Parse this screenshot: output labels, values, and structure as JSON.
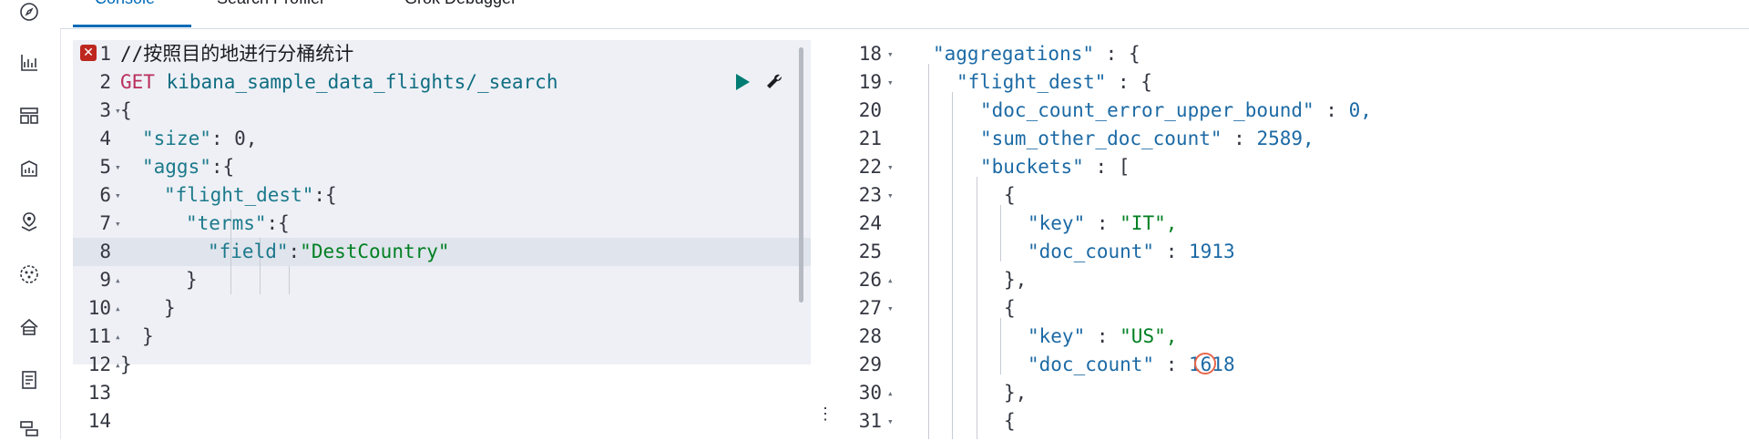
{
  "tabs": [
    {
      "label": "Console"
    },
    {
      "label": "Search Profiler"
    },
    {
      "label": "Grok Debugger"
    }
  ],
  "nav_icons": [
    "compass-icon",
    "chart-icon",
    "dashboard-icon",
    "canvas-icon",
    "maps-icon",
    "ml-icon",
    "infrastructure-icon",
    "logs-icon",
    "apm-icon"
  ],
  "request": {
    "lines": [
      {
        "n": "1",
        "fold": "",
        "text": "//按照目的地进行分桶统计"
      },
      {
        "n": "2",
        "fold": "",
        "method": "GET",
        "url": "kibana_sample_data_flights/_search"
      },
      {
        "n": "3",
        "fold": "▾",
        "text": "{"
      },
      {
        "n": "4",
        "fold": "",
        "key": "\"size\"",
        "rest": ": 0,"
      },
      {
        "n": "5",
        "fold": "▾",
        "key": "\"aggs\"",
        "rest": ":{"
      },
      {
        "n": "6",
        "fold": "▾",
        "key": "\"flight_dest\"",
        "rest": ":{"
      },
      {
        "n": "7",
        "fold": "▾",
        "key": "\"terms\"",
        "rest": ":{"
      },
      {
        "n": "8",
        "fold": "",
        "key": "\"field\"",
        "rest": ":",
        "val": "\"DestCountry\""
      },
      {
        "n": "9",
        "fold": "▴",
        "text": "}"
      },
      {
        "n": "10",
        "fold": "▴",
        "text": "}"
      },
      {
        "n": "11",
        "fold": "▴",
        "text": "}"
      },
      {
        "n": "12",
        "fold": "▴",
        "text": "}"
      },
      {
        "n": "13",
        "fold": "",
        "text": ""
      },
      {
        "n": "14",
        "fold": "",
        "text": ""
      }
    ]
  },
  "response": {
    "lines": [
      {
        "n": "18",
        "fold": "▾",
        "key": "\"aggregations\"",
        "rest": " : {"
      },
      {
        "n": "19",
        "fold": "▾",
        "key": "\"flight_dest\"",
        "rest": " : {"
      },
      {
        "n": "20",
        "fold": "",
        "key": "\"doc_count_error_upper_bound\"",
        "rest": " : ",
        "num": "0,"
      },
      {
        "n": "21",
        "fold": "",
        "key": "\"sum_other_doc_count\"",
        "rest": " : ",
        "num": "2589,"
      },
      {
        "n": "22",
        "fold": "▾",
        "key": "\"buckets\"",
        "rest": " : ["
      },
      {
        "n": "23",
        "fold": "▾",
        "text": "{"
      },
      {
        "n": "24",
        "fold": "",
        "key": "\"key\"",
        "rest": " : ",
        "val": "\"IT\","
      },
      {
        "n": "25",
        "fold": "",
        "key": "\"doc_count\"",
        "rest": " : ",
        "num": "1913"
      },
      {
        "n": "26",
        "fold": "▴",
        "text": "},"
      },
      {
        "n": "27",
        "fold": "▾",
        "text": "{"
      },
      {
        "n": "28",
        "fold": "",
        "key": "\"key\"",
        "rest": " : ",
        "val": "\"US\","
      },
      {
        "n": "29",
        "fold": "",
        "key": "\"doc_count\"",
        "rest": " : ",
        "num": "1618"
      },
      {
        "n": "30",
        "fold": "▴",
        "text": "},"
      },
      {
        "n": "31",
        "fold": "▾",
        "text": "{"
      }
    ]
  },
  "colors": {
    "accent": "#006bb8",
    "error": "#bd271e",
    "run": "#017d73"
  }
}
